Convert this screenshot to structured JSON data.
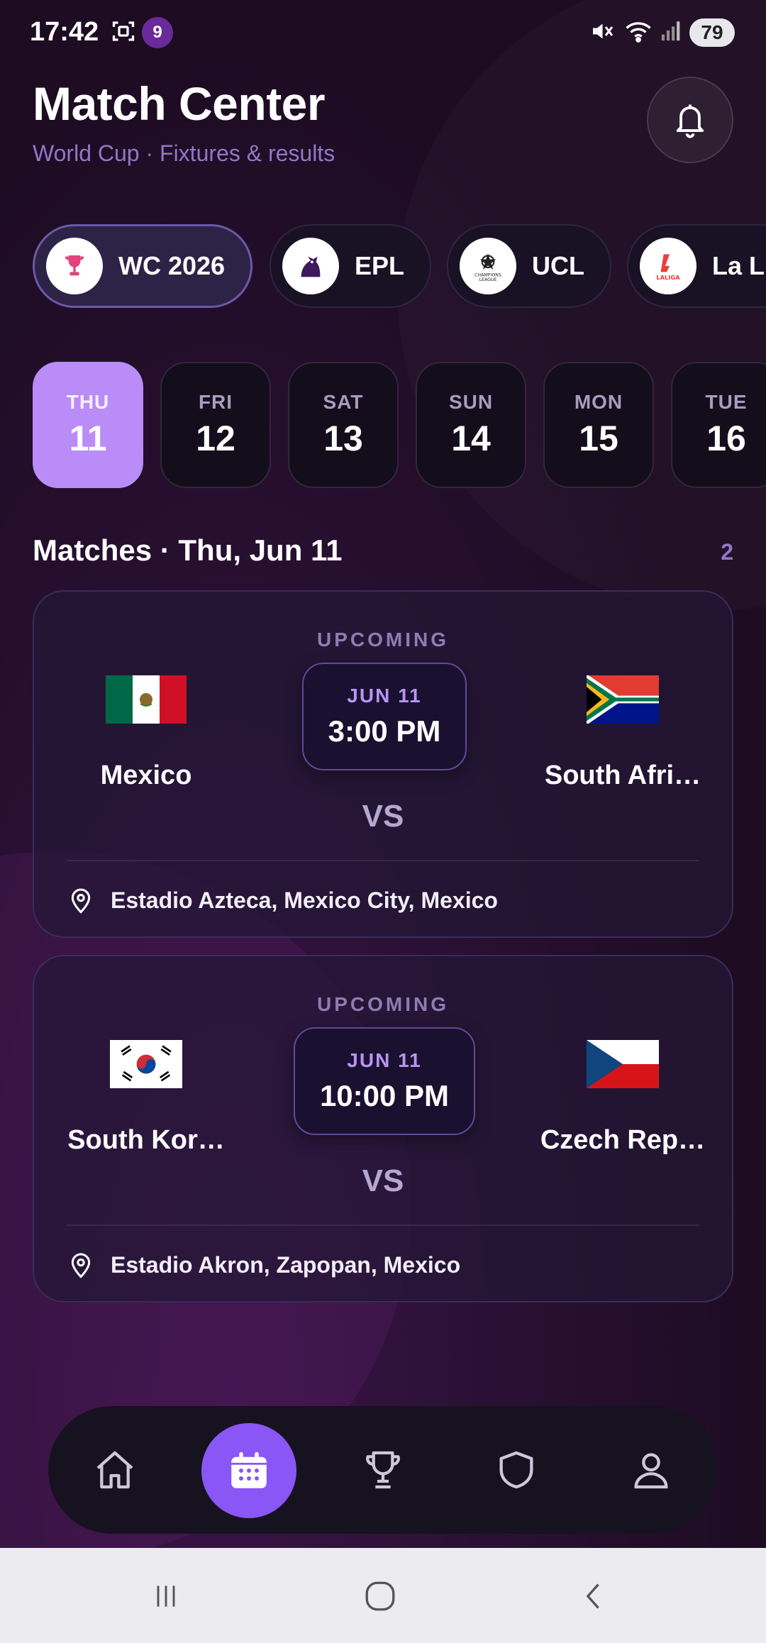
{
  "status_bar": {
    "time": "17:42",
    "notification_badge": "9",
    "battery": "79"
  },
  "header": {
    "title": "Match Center",
    "subtitle": "World Cup · Fixtures & results"
  },
  "leagues": [
    {
      "label": "WC 2026",
      "icon": "trophy-icon",
      "active": true
    },
    {
      "label": "EPL",
      "icon": "premier-league-logo",
      "active": false
    },
    {
      "label": "UCL",
      "icon": "champions-league-logo",
      "active": false
    },
    {
      "label": "La Liga",
      "icon": "laliga-logo",
      "active": false
    }
  ],
  "dates": [
    {
      "dow": "THU",
      "num": "11",
      "active": true
    },
    {
      "dow": "FRI",
      "num": "12",
      "active": false
    },
    {
      "dow": "SAT",
      "num": "13",
      "active": false
    },
    {
      "dow": "SUN",
      "num": "14",
      "active": false
    },
    {
      "dow": "MON",
      "num": "15",
      "active": false
    },
    {
      "dow": "TUE",
      "num": "16",
      "active": false
    }
  ],
  "section": {
    "title": "Matches · Thu, Jun 11",
    "count": "2"
  },
  "matches": [
    {
      "state": "UPCOMING",
      "home": {
        "name": "Mexico",
        "flag": "mexico-flag"
      },
      "away": {
        "name": "South Afri…",
        "flag": "south-africa-flag"
      },
      "date": "JUN 11",
      "time": "3:00 PM",
      "vs": "VS",
      "venue": "Estadio Azteca, Mexico City, Mexico"
    },
    {
      "state": "UPCOMING",
      "home": {
        "name": "South Kor…",
        "flag": "south-korea-flag"
      },
      "away": {
        "name": "Czech Rep…",
        "flag": "czech-flag"
      },
      "date": "JUN 11",
      "time": "10:00 PM",
      "vs": "VS",
      "venue": "Estadio Akron, Zapopan, Mexico"
    }
  ],
  "bottom_nav": [
    {
      "icon": "home-icon",
      "active": false
    },
    {
      "icon": "calendar-icon",
      "active": true
    },
    {
      "icon": "trophy-icon",
      "active": false
    },
    {
      "icon": "shield-icon",
      "active": false
    },
    {
      "icon": "profile-icon",
      "active": false
    }
  ],
  "colors": {
    "accent": "#8a56f6",
    "active_date": "#b98cf8",
    "subtitle": "#8f78c8",
    "background": "#1d0c22"
  }
}
